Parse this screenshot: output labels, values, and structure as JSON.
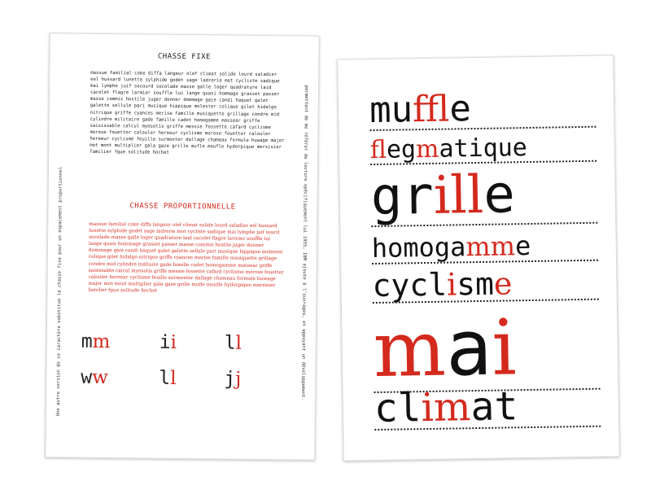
{
  "left_page": {
    "side_note_left": "Une autre version de ce caractère substitue la chasse fixe pour un espacement proportionnel",
    "side_note_right": "permettant de me référer de lecture spécifiquement lui 1955, IBM ajoute à l'ouvrages, et appuyant un développement.",
    "fixed_title": "CHASSE FIXE",
    "fixed_text": "massue familial coke diffa langeur olef climat solide lourd saladier eel hussard lunette sylphide godet sage ladrerie met cycliste sadique mai lymphe juif socourd socolade masse galle loger quadrature laid cacolet flagre larmier souffle lui lange quasi hommage grasset passer masse commis hostile juger donner dommage gaie candi haquet galet galette sellule pari musique hippique molester colique gilet hidalgo nitrique griffe cyances merise famille musiquette grillage condre mid cylindre militaire gade famille cadet homogamme massear griffe saisissable calcul myosotis griffe messie fossette cafard cyclisme morose fouetter calouler hereeur cyclisme morose fouetter calouler hereeur cyclisme feuille surmonter dallage chameau formule huwage major mot mont multiplier gala gaze grille mufle moufle hydorpique mersisier familier fgue solitude hochet",
    "prop_title": "CHASSE PROPORTIONNELLE",
    "prop_text": "massue familial coke diffa langeur olef climat solide lourd saladier eel hussard lunette sylphide godet sage ladrerie mot cycliste sadique mai lymphe juif sourd socolade masse galle loger quadrature laid cacolet flagre larmier souffle lui lange quasi hommage grasset passer masse commis hostile juger donner dommage gaie candi haquet galet galette sellule pari musique hippique molester colique gilet hidalgo nitrique griffe cyances merise famille musiquette grillage condre mid cylindre militaire gade famille cadet homogamme massear griffe saisissable calcul myosotis griffe messie fossette cafard cyclisme morose fouetter calouler hereeur cyclisme feuille surmonter dallage chameau formule huwage major mot mont multiplier gala gaze grille mufle moufle hydorpique mersisier familier fgue solitude hochet",
    "pairs": [
      {
        "a": "m",
        "b": "m"
      },
      {
        "a": "i",
        "b": "i"
      },
      {
        "a": "l",
        "b": "l"
      },
      {
        "a": "w",
        "b": "w"
      },
      {
        "a": "l",
        "b": "l"
      },
      {
        "a": "j",
        "b": "j"
      }
    ]
  },
  "right_page": {
    "words": [
      [
        {
          "t": "mu",
          "c": "k",
          "f": "mono"
        },
        {
          "t": "ffl",
          "c": "r",
          "f": "serif"
        },
        {
          "t": "e",
          "c": "k",
          "f": "mono"
        }
      ],
      [
        {
          "t": "fl",
          "c": "r",
          "f": "serif"
        },
        {
          "t": "eg",
          "c": "k",
          "f": "mono"
        },
        {
          "t": "m",
          "c": "r",
          "f": "serif"
        },
        {
          "t": "atique",
          "c": "k",
          "f": "mono"
        }
      ],
      [
        {
          "t": "gr",
          "c": "k",
          "f": "mono"
        },
        {
          "t": "ill",
          "c": "r",
          "f": "serif"
        },
        {
          "t": "e",
          "c": "k",
          "f": "mono"
        }
      ],
      [
        {
          "t": "homoga",
          "c": "k",
          "f": "mono"
        },
        {
          "t": "mm",
          "c": "r",
          "f": "serif"
        },
        {
          "t": "e",
          "c": "k",
          "f": "mono"
        }
      ],
      [
        {
          "t": "cycl",
          "c": "k",
          "f": "mono"
        },
        {
          "t": "i",
          "c": "r",
          "f": "serif"
        },
        {
          "t": "sm",
          "c": "k",
          "f": "mono"
        },
        {
          "t": "e",
          "c": "r",
          "f": "serif"
        }
      ],
      [
        {
          "t": "m",
          "c": "r",
          "f": "serif"
        },
        {
          "t": "a",
          "c": "k",
          "f": "mono"
        },
        {
          "t": "i",
          "c": "r",
          "f": "serif"
        }
      ],
      [
        {
          "t": "cl",
          "c": "k",
          "f": "mono"
        },
        {
          "t": "im",
          "c": "r",
          "f": "serif"
        },
        {
          "t": "at",
          "c": "k",
          "f": "mono"
        }
      ]
    ]
  }
}
